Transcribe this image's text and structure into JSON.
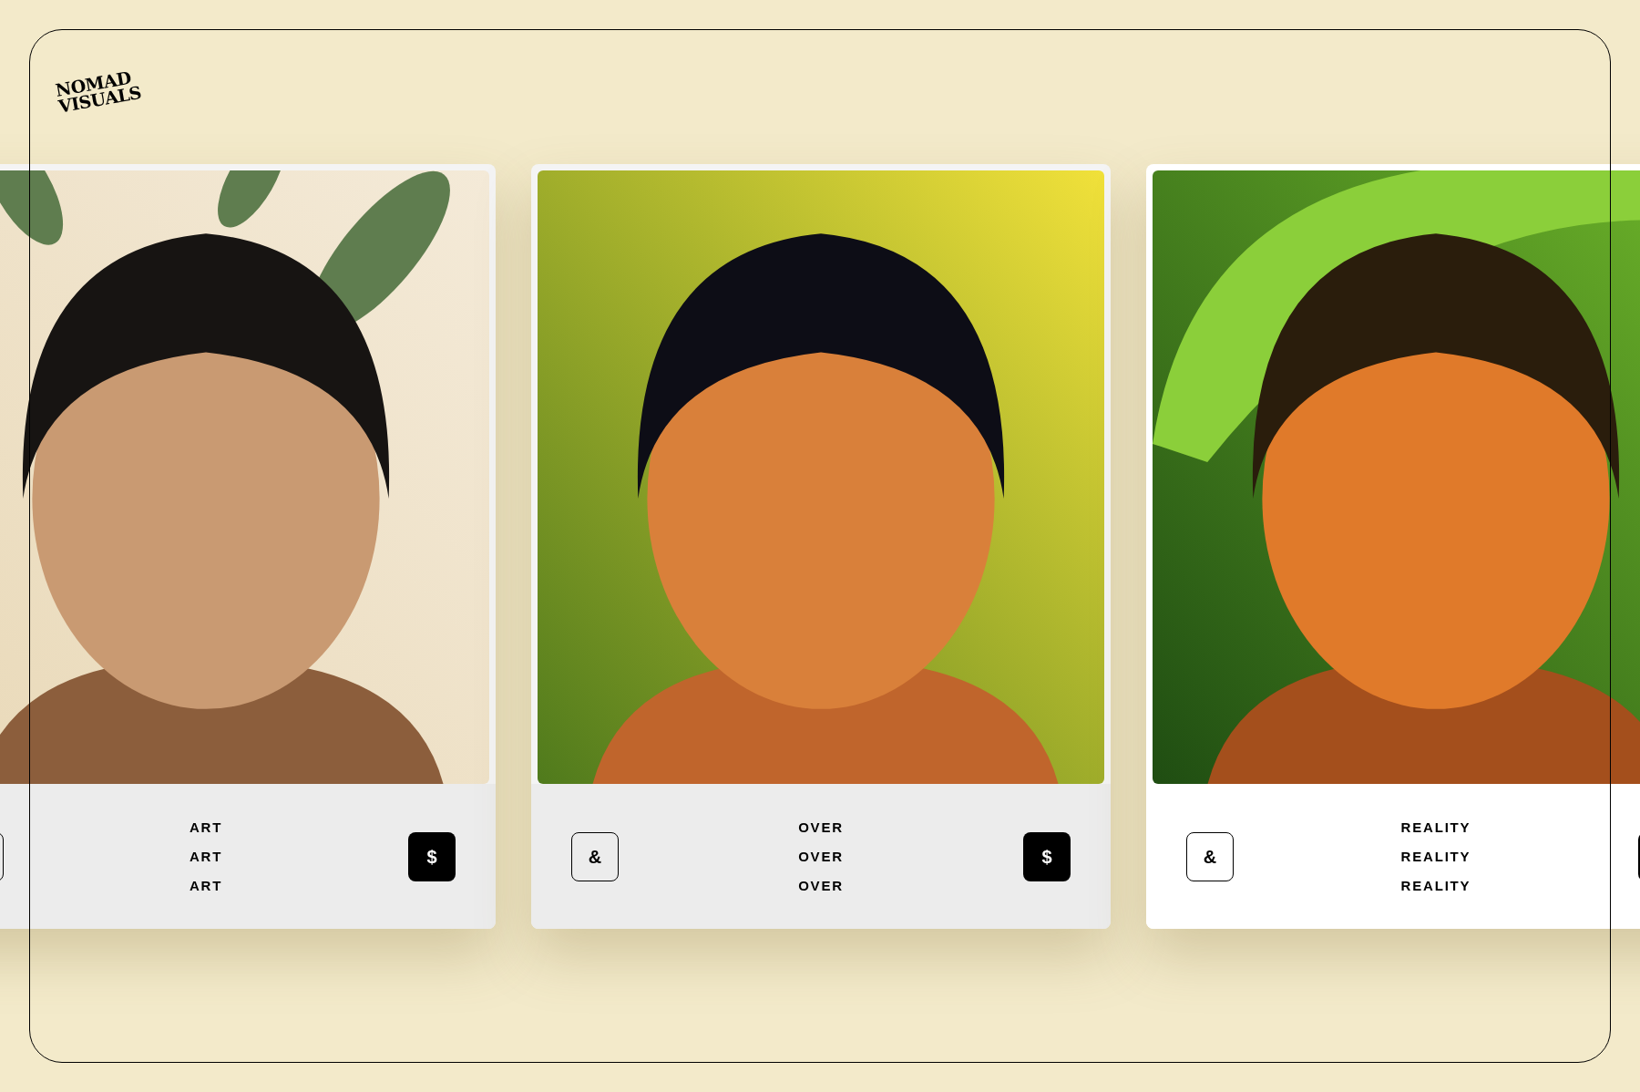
{
  "logo": "NOMAD\nVISUALS",
  "cards": [
    {
      "kind": "picture",
      "selected": false,
      "buttons": [
        {
          "kind": "outline"
        },
        {
          "kind": "solid",
          "label": "$"
        }
      ],
      "lines": [
        "ART",
        "ART",
        "ART"
      ]
    },
    {
      "kind": "picture",
      "selected": false,
      "buttons": [
        {
          "kind": "outline",
          "label": "&"
        },
        {
          "kind": "solid",
          "label": "$"
        }
      ],
      "lines": [
        "OVER",
        "OVER",
        "OVER"
      ]
    },
    {
      "kind": "picture",
      "selected": true,
      "buttons": [
        {
          "kind": "outline",
          "label": "&"
        },
        {
          "kind": "solid"
        }
      ],
      "lines": [
        "REALITY",
        "REALITY",
        "REALITY"
      ]
    }
  ]
}
